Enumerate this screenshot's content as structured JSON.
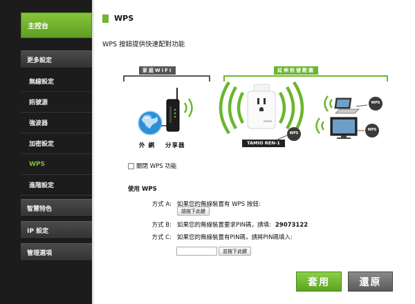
{
  "sidebar": {
    "main": "主控台",
    "more_settings": "更多設定",
    "wireless": "無線設定",
    "sub_items": [
      "訊號源",
      "強波器",
      "加密設定",
      "WPS",
      "進階設定"
    ],
    "smart": "智慧特色",
    "ip": "IP 設定",
    "manage": "管理選項"
  },
  "page": {
    "title": "WPS",
    "description": "WPS 按鈕提供快速配對功能"
  },
  "diagram": {
    "home_wifi": "家庭WiFi",
    "extended_range": "延伸訊號範圍",
    "external_network": "外 網",
    "router": "分享器",
    "device_name": "TAMIO REN-1",
    "wps_badge": "WPS"
  },
  "wps": {
    "disable_label": "關閉 WPS 功能",
    "use_title": "使用 WPS",
    "method_a_label": "方式 A:",
    "method_a_text": "如果您的無線裝置有 WPS 按鈕:",
    "method_a_button": "請按下此鍵",
    "method_b_label": "方式 B:",
    "method_b_text": "如果您的無線裝置要求PIN碼，請填:",
    "pin_code": "29073122",
    "method_c_label": "方式 C:",
    "method_c_text": "如果您的無線裝置有PIN碼，請將PIN碼填入:",
    "method_c_button": "並按下此鍵",
    "pin_input_value": ""
  },
  "actions": {
    "apply": "套用",
    "restore": "還原"
  },
  "colors": {
    "accent": "#6fb52e",
    "sidebar_bg": "#1c1c1c",
    "restore_btn": "#6a6a6a"
  }
}
